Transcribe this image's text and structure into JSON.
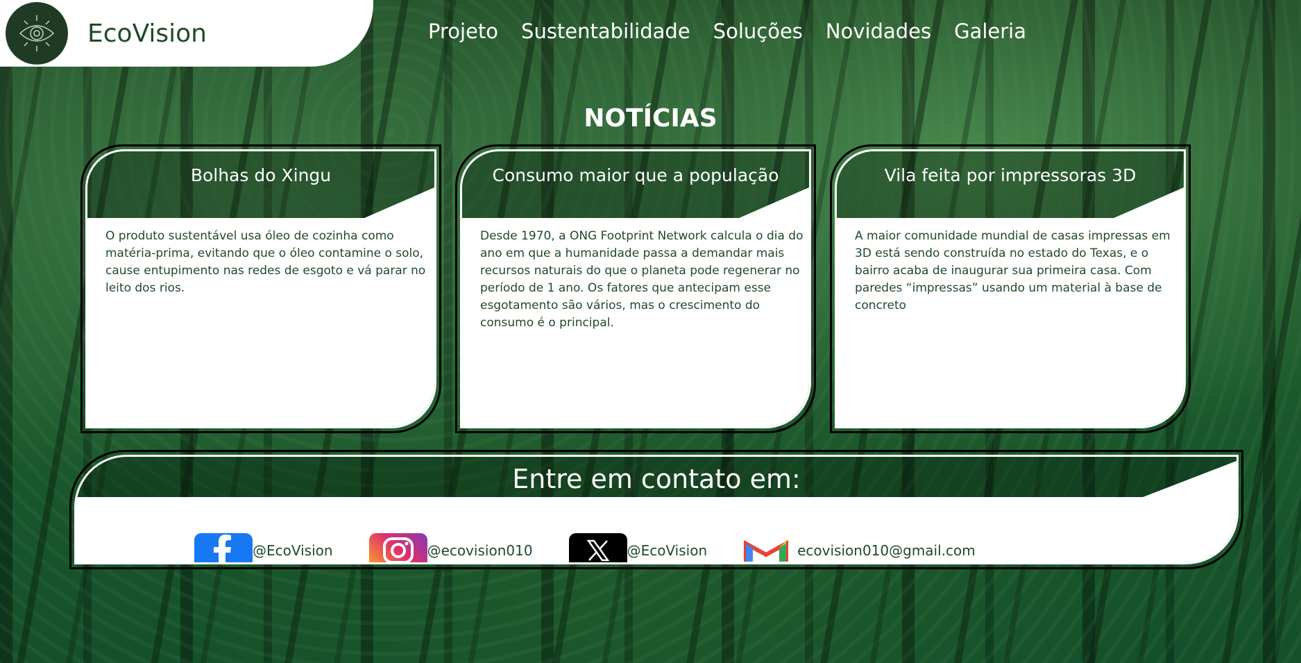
{
  "brand": {
    "name": "EcoVision"
  },
  "nav": {
    "items": [
      "Projeto",
      "Sustentabilidade",
      "Soluções",
      "Novidades",
      "Galeria"
    ]
  },
  "news": {
    "title": "NOTÍCIAS",
    "cards": [
      {
        "title": "Bolhas do Xingu",
        "text": "O produto sustentável usa óleo de cozinha como matéria-prima, evitando que o óleo contamine o solo, cause entupimento nas redes de esgoto e vá parar no leito dos rios."
      },
      {
        "title": "Consumo maior que a população",
        "text": "Desde 1970, a ONG Footprint Network calcula o dia do ano em que a humanidade passa a demandar mais recursos naturais do que o planeta pode regenerar no período de 1 ano. Os fatores que antecipam esse esgotamento são vários, mas o crescimento do consumo é o principal."
      },
      {
        "title": "Vila feita por impressoras 3D",
        "text": "A maior comunidade mundial de casas impressas em 3D está sendo construída no estado do Texas, e o bairro acaba de inaugurar sua primeira casa. Com paredes “impressas” usando um material à base de concreto"
      }
    ]
  },
  "contact": {
    "title": "Entre em contato em:",
    "socials": [
      {
        "icon": "facebook-icon",
        "handle": "@EcoVision"
      },
      {
        "icon": "instagram-icon",
        "handle": "@ecovision010"
      },
      {
        "icon": "x-icon",
        "handle": "@EcoVision"
      },
      {
        "icon": "gmail-icon",
        "handle": "ecovision010@gmail.com"
      }
    ]
  },
  "colors": {
    "text_dark_green": "#1f4a2a",
    "facebook": "#1877f2",
    "x": "#000000"
  }
}
